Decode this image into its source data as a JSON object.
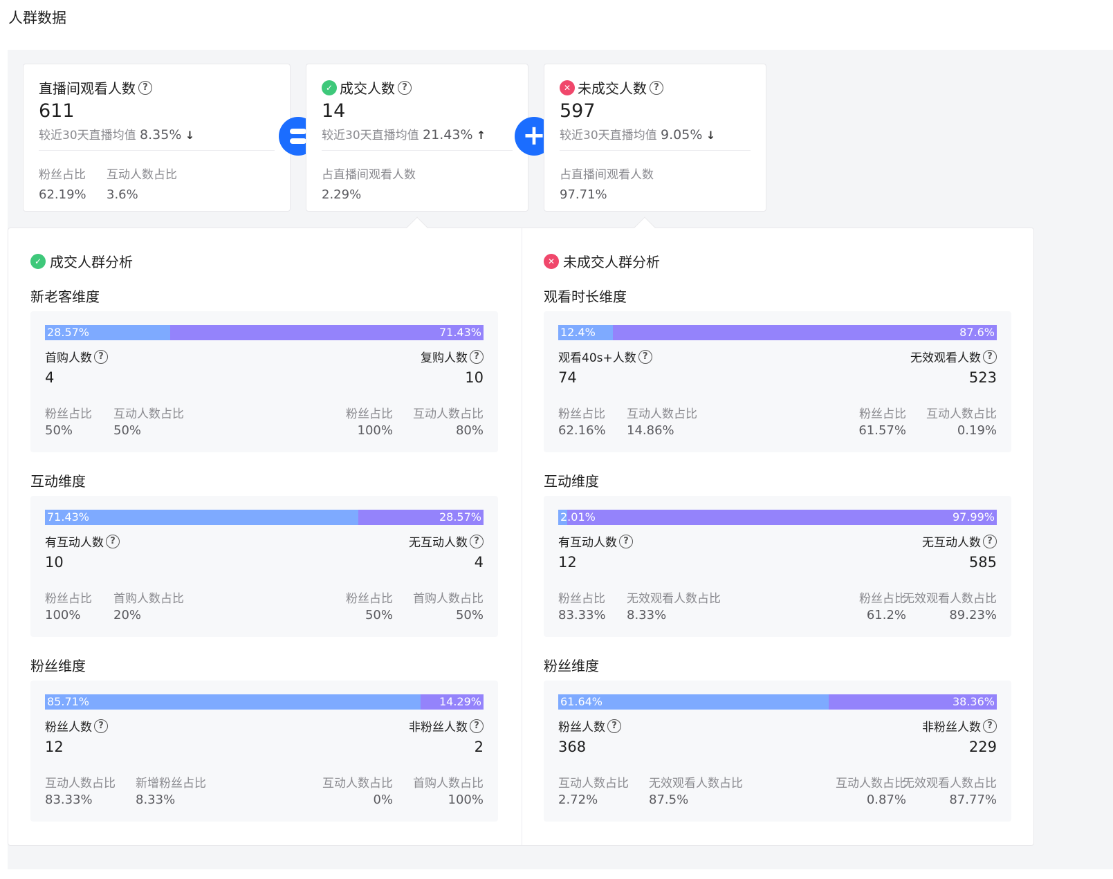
{
  "page": {
    "title": "人群数据"
  },
  "cards": {
    "watch": {
      "title": "直播间观看人数",
      "value": "611",
      "compare_label": "较近30天直播均值",
      "compare_pct": "8.35%",
      "trend": "down",
      "m1_label": "粉丝占比",
      "m1_value": "62.19%",
      "m2_label": "互动人数占比",
      "m2_value": "3.6%"
    },
    "deal": {
      "title": "成交人数",
      "value": "14",
      "compare_label": "较近30天直播均值",
      "compare_pct": "21.43%",
      "trend": "up",
      "m1_label": "占直播间观看人数",
      "m1_value": "2.29%"
    },
    "nodeal": {
      "title": "未成交人数",
      "value": "597",
      "compare_label": "较近30天直播均值",
      "compare_pct": "9.05%",
      "trend": "down",
      "m1_label": "占直播间观看人数",
      "m1_value": "97.71%"
    }
  },
  "icons": {
    "arrow_down": "↓",
    "arrow_up": "↑",
    "help": "?",
    "equals": "equals-icon",
    "plus": "+"
  },
  "colors": {
    "accent": "#1b6dff",
    "bar_left": "#7eaaff",
    "bar_right": "#9483fb",
    "deal_badge": "#3ec87a",
    "nodeal_badge": "#f0476b"
  },
  "left": {
    "title": "成交人群分析",
    "dims": [
      {
        "title": "新老客维度",
        "left_pct": "28.57%",
        "right_pct": "71.43%",
        "left_frac": 0.2857,
        "left_label": "首购人数",
        "right_label": "复购人数",
        "left_num": "4",
        "right_num": "10",
        "lm1_label": "粉丝占比",
        "lm1_value": "50%",
        "lm2_label": "互动人数占比",
        "lm2_value": "50%",
        "rm1_label": "粉丝占比",
        "rm1_value": "100%",
        "rm2_label": "互动人数占比",
        "rm2_value": "80%"
      },
      {
        "title": "互动维度",
        "left_pct": "71.43%",
        "right_pct": "28.57%",
        "left_frac": 0.7143,
        "left_label": "有互动人数",
        "right_label": "无互动人数",
        "left_num": "10",
        "right_num": "4",
        "lm1_label": "粉丝占比",
        "lm1_value": "100%",
        "lm2_label": "首购人数占比",
        "lm2_value": "20%",
        "rm1_label": "粉丝占比",
        "rm1_value": "50%",
        "rm2_label": "首购人数占比",
        "rm2_value": "50%"
      },
      {
        "title": "粉丝维度",
        "left_pct": "85.71%",
        "right_pct": "14.29%",
        "left_frac": 0.8571,
        "left_label": "粉丝人数",
        "right_label": "非粉丝人数",
        "left_num": "12",
        "right_num": "2",
        "lm1_label": "互动人数占比",
        "lm1_value": "83.33%",
        "lm2_label": "新增粉丝占比",
        "lm2_value": "8.33%",
        "rm1_label": "互动人数占比",
        "rm1_value": "0%",
        "rm2_label": "首购人数占比",
        "rm2_value": "100%"
      }
    ]
  },
  "right": {
    "title": "未成交人群分析",
    "dims": [
      {
        "title": "观看时长维度",
        "left_pct": "12.4%",
        "right_pct": "87.6%",
        "left_frac": 0.124,
        "left_label": "观看40s+人数",
        "right_label": "无效观看人数",
        "left_num": "74",
        "right_num": "523",
        "lm1_label": "粉丝占比",
        "lm1_value": "62.16%",
        "lm2_label": "互动人数占比",
        "lm2_value": "14.86%",
        "rm1_label": "粉丝占比",
        "rm1_value": "61.57%",
        "rm2_label": "互动人数占比",
        "rm2_value": "0.19%"
      },
      {
        "title": "互动维度",
        "left_pct": "2.01%",
        "right_pct": "97.99%",
        "left_frac": 0.0201,
        "left_label": "有互动人数",
        "right_label": "无互动人数",
        "left_num": "12",
        "right_num": "585",
        "lm1_label": "粉丝占比",
        "lm1_value": "83.33%",
        "lm2_label": "无效观看人数占比",
        "lm2_value": "8.33%",
        "rm1_label": "粉丝占比",
        "rm1_value": "61.2%",
        "rm2_label": "无效观看人数占比",
        "rm2_value": "89.23%"
      },
      {
        "title": "粉丝维度",
        "left_pct": "61.64%",
        "right_pct": "38.36%",
        "left_frac": 0.6164,
        "left_label": "粉丝人数",
        "right_label": "非粉丝人数",
        "left_num": "368",
        "right_num": "229",
        "lm1_label": "互动人数占比",
        "lm1_value": "2.72%",
        "lm2_label": "无效观看人数占比",
        "lm2_value": "87.5%",
        "rm1_label": "互动人数占比",
        "rm1_value": "0.87%",
        "rm2_label": "无效观看人数占比",
        "rm2_value": "87.77%"
      }
    ]
  }
}
